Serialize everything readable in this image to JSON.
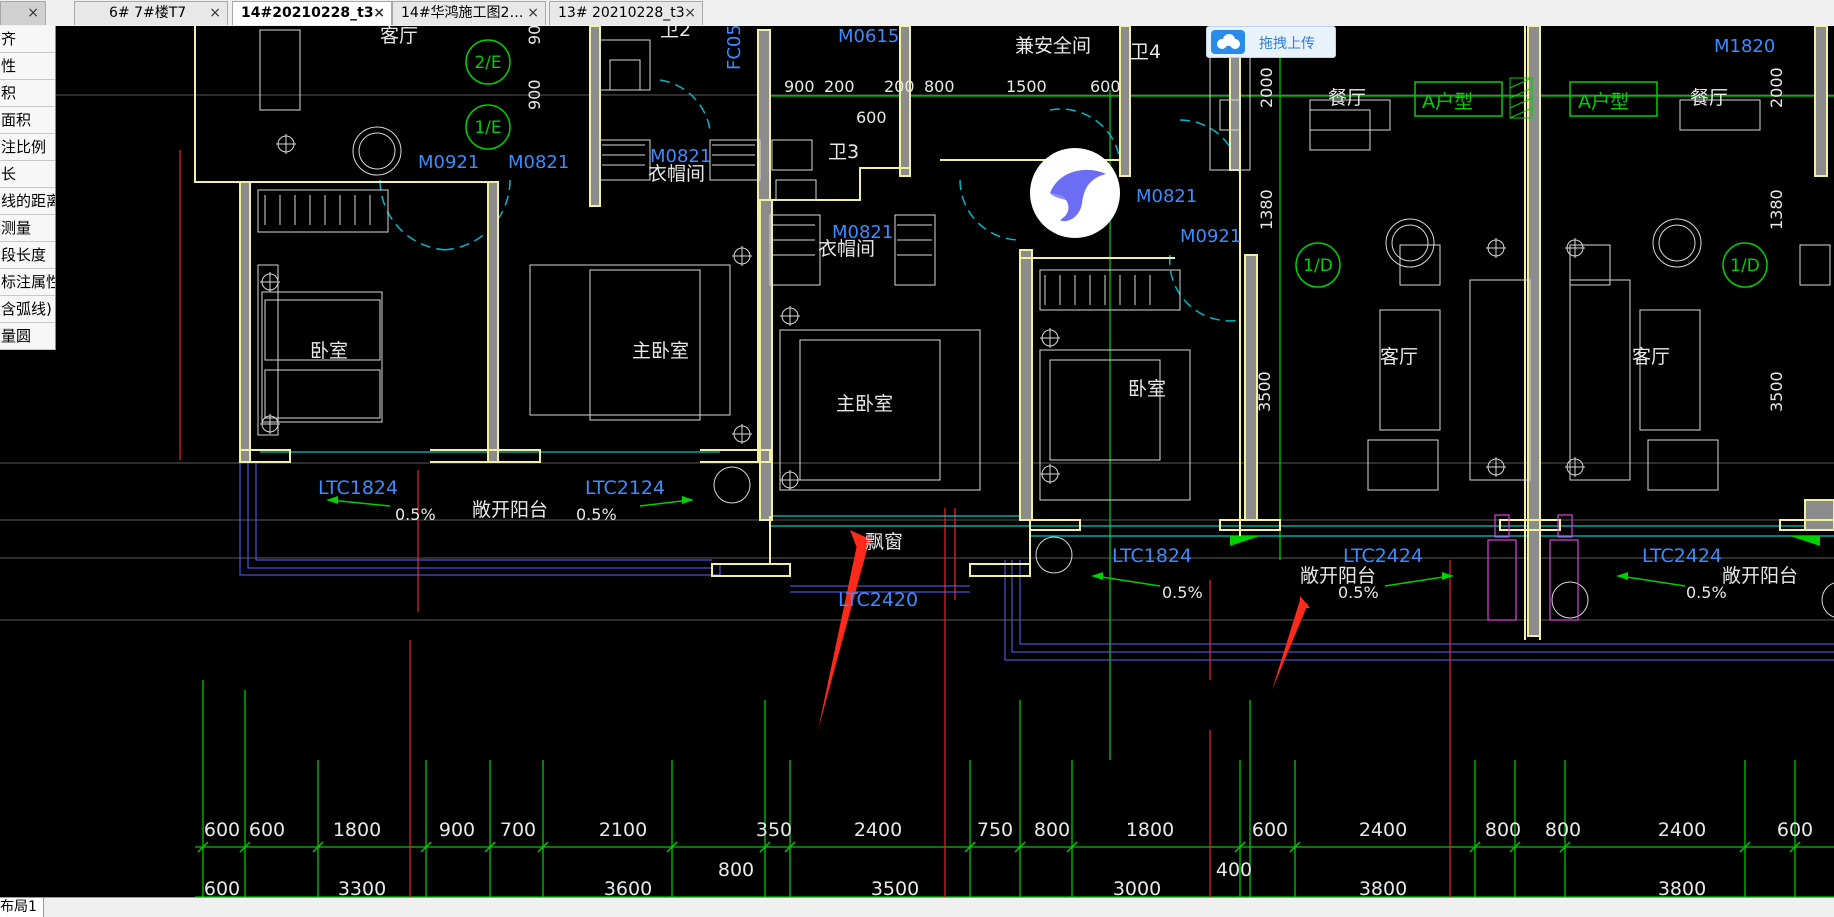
{
  "tabs": [
    {
      "label": "",
      "close": "×"
    },
    {
      "label": "6# 7#楼T7",
      "close": "×"
    },
    {
      "label": "14#20210228_t3",
      "close": "×",
      "active": true
    },
    {
      "label": "14#华鸿施工图2…",
      "close": "×"
    },
    {
      "label": "13# 20210228_t3",
      "close": "×"
    }
  ],
  "cmd_menu": {
    "items": [
      "齐",
      "性",
      "积",
      "面积",
      "注比例",
      "长",
      "线的距离",
      "测量",
      "段长度",
      "标注属性",
      "含弧线)",
      "量圆"
    ]
  },
  "upload": {
    "label": "拖拽上传",
    "icon": "cloud-upload-icon"
  },
  "bird_icon": "bird-app-icon",
  "status_bar": {
    "layout_tab": "布局1"
  },
  "drawing": {
    "room_labels": [
      {
        "text": "客厅",
        "name": "room-living-top"
      },
      {
        "text": "卫2",
        "name": "room-bath2"
      },
      {
        "text": "兼安全间",
        "name": "room-safe"
      },
      {
        "text": "卫4",
        "name": "room-bath4"
      },
      {
        "text": "卫3",
        "name": "room-bath3"
      },
      {
        "text": "衣帽间",
        "name": "room-closet-1"
      },
      {
        "text": "衣帽间",
        "name": "room-closet-2"
      },
      {
        "text": "卧室",
        "name": "room-bedroom-1"
      },
      {
        "text": "主卧室",
        "name": "room-master-1"
      },
      {
        "text": "主卧室",
        "name": "room-master-2"
      },
      {
        "text": "卧室",
        "name": "room-bedroom-2"
      },
      {
        "text": "客厅",
        "name": "room-living-1"
      },
      {
        "text": "客厅",
        "name": "room-living-2"
      },
      {
        "text": "餐厅",
        "name": "room-dining-1"
      },
      {
        "text": "餐厅",
        "name": "room-dining-2"
      },
      {
        "text": "敞开阳台",
        "name": "balcony-1"
      },
      {
        "text": "敞开阳台",
        "name": "balcony-2"
      },
      {
        "text": "敞开阳台",
        "name": "balcony-3"
      },
      {
        "text": "飘窗",
        "name": "bay-window"
      }
    ],
    "unit_types": [
      "A户型",
      "A户型"
    ],
    "window_tags": [
      "LTC1824",
      "LTC2124",
      "LTC1824",
      "LTC2424",
      "LTC2424",
      "LTC2420"
    ],
    "door_tags": [
      "M0921",
      "M0821",
      "M0821",
      "M0821",
      "M0821",
      "M0921",
      "M1820",
      "M0615",
      "FC05"
    ],
    "axis_bubbles": [
      "2/E",
      "1/E",
      "1/D",
      "1/D"
    ],
    "slopes": [
      "0.5%",
      "0.5%",
      "0.5%",
      "0.5%",
      "0.5%"
    ],
    "inner_dims": [
      "900",
      "200",
      "200",
      "800",
      "1500",
      "600",
      "600",
      "900",
      "900",
      "2000",
      "2000",
      "1380",
      "1380",
      "3500",
      "3500"
    ],
    "dims_row1": [
      "600",
      "600",
      "1800",
      "900",
      "700",
      "2100",
      "350",
      "2400",
      "750",
      "800",
      "1800",
      "600",
      "2400",
      "800",
      "800",
      "2400",
      "600"
    ],
    "dims_row2": [
      "600",
      "3300",
      "3600",
      "800",
      "3500",
      "3000",
      "400",
      "3800",
      "3800"
    ]
  },
  "colors": {
    "wall": "#f0f0a0",
    "green": "#00d000",
    "blue": "#3a8cff",
    "cyan": "#00c8c8",
    "red": "#e02020",
    "white": "#e8e8e8",
    "magenta": "#e040e0",
    "arrow": "#ff2a1a"
  }
}
